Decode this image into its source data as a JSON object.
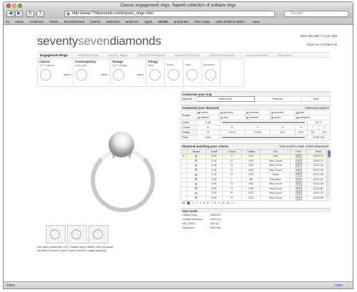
{
  "window": {
    "title": "Classic engagement rings: Superb collection of solitaire rings"
  },
  "toolbar": {
    "url": "http://www.77diamonds.com/classic_rings.html",
    "search_placeholder": "Google"
  },
  "bookmarks": [
    "JS",
    "News",
    "Academia",
    "Travel",
    "Miscellaneous",
    "Search",
    "webTools",
    "webCom",
    "Apple",
    "talktalk",
    "properties",
    "Parc Adula",
    "Valle di Blenio Bleni...",
    "casa"
  ],
  "site": {
    "logo_a": "seventy",
    "logo_b": "seven",
    "logo_c": "diamonds",
    "phone": "0844 561 6877 | Live chat",
    "about": "About us | Contact us"
  },
  "nav": [
    "Engagement Rings",
    "Wedding Rings",
    "Eternity Rings",
    "Diamond Necklaces",
    "Diamond Earrings",
    "Diamond Jewellery",
    "Loose Diamonds",
    "Education"
  ],
  "categories": [
    {
      "title": "Classic",
      "sub": "1477 Classic",
      "select": "select"
    },
    {
      "title": "Contemporary",
      "sub": "North Star",
      "select": "select"
    },
    {
      "title": "Vintage",
      "sub": "1477 Vintage",
      "select": "select"
    },
    {
      "title": "Trilogy",
      "sub": "Paris",
      "select": ""
    },
    {
      "title": "",
      "sub": "Roma",
      "select": ""
    },
    {
      "title": "",
      "sub": "Calm",
      "select": ""
    },
    {
      "title": "",
      "sub": "Barcelona",
      "select": ""
    }
  ],
  "chosen_text": "You have chosen the 1477 Classic ring in White Gold (18 karat) set with a Round 0.18ct F colour and VS1 clarity diamond.",
  "customize_ring": {
    "heading": "Customize your ring",
    "material_label": "Material",
    "materials": [
      "White Gold",
      "Platinum",
      "Gold"
    ]
  },
  "customize_diamond": {
    "heading": "Customize your diamond",
    "advanced": "Advanced options",
    "shape_label": "Shape",
    "shapes_row1": [
      "round",
      "princess",
      "emerald",
      "asscher",
      "pear"
    ],
    "shapes_row2": [
      "radiant",
      "oval",
      "cushion",
      "heart",
      "marquise"
    ],
    "carat_label": "Carat",
    "carat_min": "0.18",
    "carat_max": "10.71",
    "colour_label": "Colour",
    "colours": [
      "D",
      "E",
      "F",
      "G",
      "H",
      "I",
      "J"
    ],
    "clarity_label": "Clarity",
    "clarities": [
      "IF",
      "VVS1",
      "VVS2",
      "VS1",
      "VS2",
      "SI1",
      "SI2"
    ],
    "price_label": "Price",
    "price_min": "£181",
    "price_max": "£769,143"
  },
  "matching": {
    "heading": "Diamond matching your criteria",
    "result": "Your search result: 27633 diamonds.",
    "columns": [
      "Shape",
      "Carat",
      "Colour",
      "Clarity",
      "Cut",
      "Cert.",
      "Price"
    ],
    "rows": [
      [
        "0.18",
        "F",
        "VS1",
        "Fair",
        "GIA",
        "£202.14"
      ],
      [
        "0.16",
        "D",
        "VS2",
        "Very Good",
        "GIA",
        "£204.72"
      ],
      [
        "0.16",
        "D",
        "VS2",
        "Very Good",
        "GIA",
        "£207.26"
      ],
      [
        "0.16",
        "D",
        "VS2",
        "Very Good",
        "GIA",
        "£207.29"
      ],
      [
        "0.16",
        "H",
        "VS2",
        "Good",
        "GIA",
        "£210.03"
      ],
      [
        "0.30",
        "I",
        "SI3",
        "Excellent",
        "GIA",
        "£210.81"
      ],
      [
        "0.20",
        "H",
        "VS2",
        "Very Good",
        "GIA",
        "£214.03"
      ],
      [
        "0.20",
        "H",
        "VS2",
        "Very Good",
        "GIA",
        "£218.81"
      ],
      [
        "0.20",
        "E",
        "VS2",
        "Very Good",
        "GIA",
        "£221.74"
      ],
      [
        "0.20",
        "H",
        "VS2",
        "Very Good",
        "GIA",
        "£224.60"
      ]
    ],
    "pager": [
      "50",
      "1",
      "2",
      "3",
      "4",
      "5",
      "6",
      "7",
      "8",
      "9",
      "10",
      "11",
      ">>"
    ]
  },
  "order": {
    "heading": "Your order",
    "rows": [
      [
        "Chosen ring",
        "£250.00"
      ],
      [
        "Chosen diamond",
        "£202.14"
      ],
      [
        "VAT (15%)",
        "£67.82"
      ],
      [
        "Total price",
        "£519.96"
      ]
    ]
  },
  "status": {
    "left": "Done",
    "right": "anbe"
  }
}
